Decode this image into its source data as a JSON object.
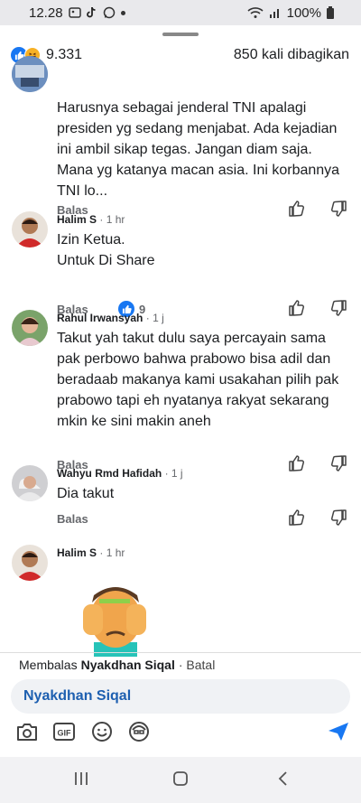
{
  "status": {
    "time": "12.28",
    "battery": "100%"
  },
  "reactions": {
    "count": "9.331",
    "shares": "850 kali dibagikan"
  },
  "comments": [
    {
      "name": "",
      "time": "",
      "text": "Harusnya sebagai jenderal TNI apalagi presiden yg sedang menjabat. Ada kejadian ini ambil sikap tegas. Jangan diam saja. Mana yg katanya macan asia. Ini korbannya TNI lo...",
      "reply": "Balas",
      "likes": ""
    },
    {
      "name": "Halim S",
      "time": "1 hr",
      "text_lines": [
        "Izin Ketua.",
        "Untuk Di Share"
      ],
      "reply": "Balas",
      "likes": "9"
    },
    {
      "name": "Rahul Irwansyah",
      "time": "1 j",
      "text": "Takut yah takut dulu saya percayain sama pak perbowo bahwa prabowo bisa adil dan beradaab makanya kami usakahan pilih pak prabowo tapi eh nyatanya rakyat sekarang mkin ke sini makin aneh",
      "reply": "Balas",
      "likes": ""
    },
    {
      "name": "Wahyu Rmd Hafidah",
      "time": "1 j",
      "text": "Dia takut",
      "reply": "Balas",
      "likes": ""
    },
    {
      "name": "Halim S",
      "time": "1 hr",
      "text": "",
      "reply": "",
      "likes": ""
    }
  ],
  "reply_bar": {
    "prefix": "Membalas",
    "target": "Nyakdhan Siqal",
    "cancel": "· Batal"
  },
  "input": {
    "value": "Nyakdhan Siqal"
  },
  "colors": {
    "accent": "#1877f2",
    "mention": "#1d5fb0"
  }
}
